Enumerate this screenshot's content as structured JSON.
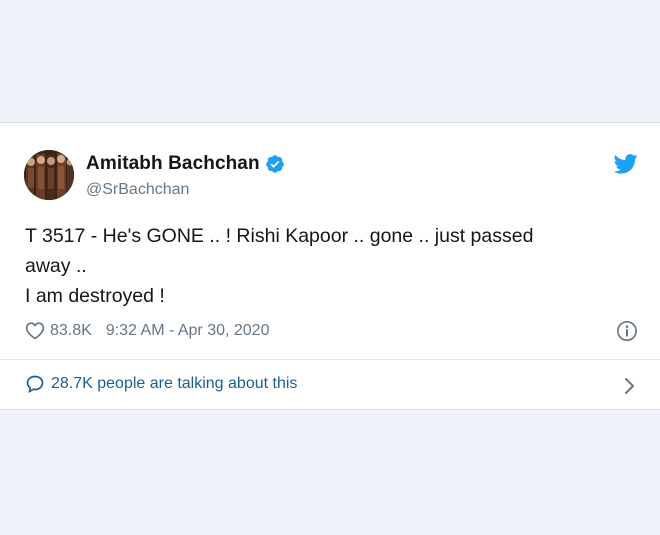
{
  "tweet": {
    "author": {
      "display_name": "Amitabh Bachchan",
      "handle": "@SrBachchan",
      "verified": true,
      "verified_icon": "verified-badge-icon",
      "avatar": "profile-photo"
    },
    "brand_icon": "twitter-bird-icon",
    "text_lines": [
      "T 3517 - He's GONE .. ! Rishi Kapoor .. gone .. just passed",
      "away ..",
      "I am destroyed !"
    ],
    "likes_icon": "heart-icon",
    "likes": "83.8K",
    "timestamp": "9:32 AM - Apr 30, 2020",
    "info_icon": "info-icon",
    "conversation_icon": "speech-bubble-icon",
    "conversation_text": "28.7K people are talking about this",
    "chevron_icon": "chevron-right-icon"
  },
  "colors": {
    "background": "#eef2f9",
    "card": "#ffffff",
    "twitter_blue": "#1da1f2",
    "secondary_text": "#657786",
    "link_text": "#1b5f8f"
  }
}
